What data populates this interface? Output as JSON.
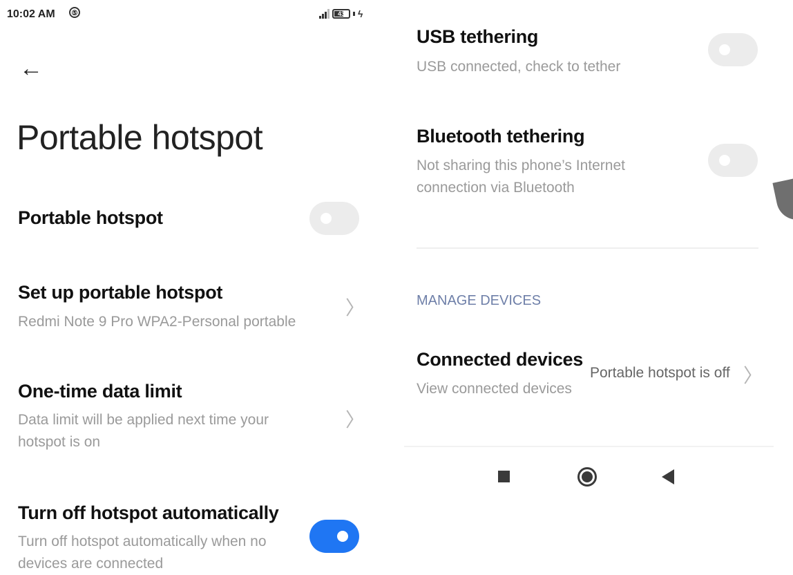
{
  "status_bar": {
    "time": "10:02 AM",
    "dnd_glyph": "⑤",
    "battery": "43",
    "charge_glyph": "ϟ"
  },
  "left": {
    "back_glyph": "←",
    "page_title": "Portable hotspot",
    "items": [
      {
        "title": "Portable hotspot",
        "toggle": "off"
      },
      {
        "title": "Set up portable hotspot",
        "subtitle": "Redmi Note 9 Pro WPA2-Personal portable"
      },
      {
        "title": "One-time data limit",
        "subtitle_1": "Data limit will be applied next time your",
        "subtitle_2": "hotspot is on"
      },
      {
        "title": "Turn off hotspot automatically",
        "subtitle_1": "Turn off hotspot automatically when no",
        "subtitle_2": "devices are connected",
        "toggle": "on"
      }
    ]
  },
  "right": {
    "usb": {
      "title": "USB tethering",
      "subtitle": "USB connected, check to tether",
      "toggle": "off"
    },
    "bluetooth": {
      "title": "Bluetooth tethering",
      "subtitle_1": "Not sharing this phone’s Internet",
      "subtitle_2": "connection via Bluetooth",
      "toggle": "off"
    },
    "section_label": "MANAGE DEVICES",
    "connected": {
      "title": "Connected devices",
      "subtitle": "View connected devices",
      "value": "Portable hotspot is off"
    }
  },
  "chevron_glyph": "〉",
  "nav": {
    "icons": [
      "recents-square-icon",
      "home-circle-icon",
      "back-triangle-icon"
    ]
  },
  "colors": {
    "accent": "#1f76f3",
    "toggle_off": "#ececec",
    "section_label": "#6e7fa8",
    "subtitle": "#9a9a9a"
  }
}
